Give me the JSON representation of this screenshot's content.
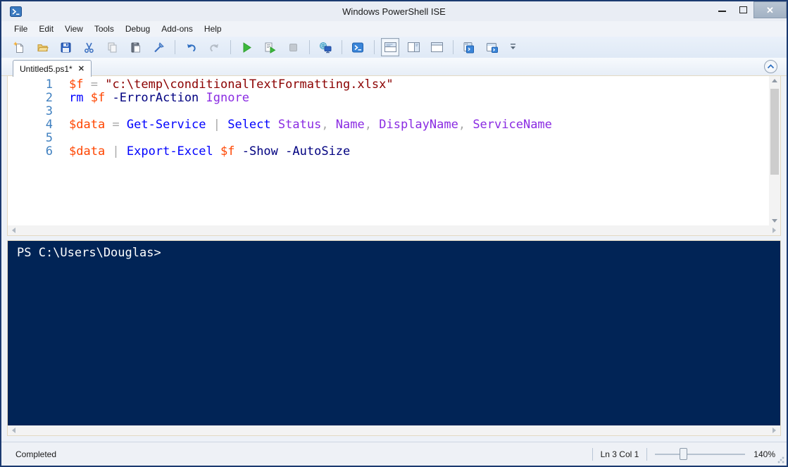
{
  "window": {
    "title": "Windows PowerShell ISE",
    "controls": [
      "minimize-icon",
      "maximize-icon",
      "close-icon"
    ]
  },
  "menu": {
    "items": [
      "File",
      "Edit",
      "View",
      "Tools",
      "Debug",
      "Add-ons",
      "Help"
    ]
  },
  "toolbar": {
    "items": [
      "new-script-icon",
      "open-script-icon",
      "save-icon",
      "cut-icon",
      "copy-icon",
      "paste-icon",
      "clear-console-icon",
      "undo-icon",
      "redo-icon",
      "run-script-icon",
      "run-selection-icon",
      "stop-icon",
      "new-remote-powershell-tab-icon",
      "start-powershell-icon",
      "show-script-pane-top-icon",
      "show-script-pane-right-icon",
      "show-script-pane-maximized-icon",
      "new-powershell-tab-icon",
      "start-powershell-exe-icon",
      "toolbar-overflow-icon"
    ]
  },
  "tabs": {
    "active": {
      "label": "Untitled5.ps1*",
      "close_glyph": "✕"
    }
  },
  "editor": {
    "token_colors": {
      "plain": "#000000",
      "variable": "#ff4500",
      "operator": "#a9a9a9",
      "string": "#8b0000",
      "cmdlet": "#0000ff",
      "parameter": "#000080",
      "argument": "#8a2be2"
    },
    "line_number_color": "#4080c0",
    "lines": [
      {
        "num": "1",
        "tokens": [
          [
            "variable",
            "$f"
          ],
          [
            "operator",
            " = "
          ],
          [
            "string",
            "\"c:\\temp\\conditionalTextFormatting.xlsx\""
          ]
        ]
      },
      {
        "num": "2",
        "tokens": [
          [
            "cmdlet",
            "rm"
          ],
          [
            "plain",
            " "
          ],
          [
            "variable",
            "$f"
          ],
          [
            "plain",
            " "
          ],
          [
            "parameter",
            "-ErrorAction"
          ],
          [
            "plain",
            " "
          ],
          [
            "argument",
            "Ignore"
          ]
        ]
      },
      {
        "num": "3",
        "tokens": []
      },
      {
        "num": "4",
        "tokens": [
          [
            "variable",
            "$data"
          ],
          [
            "operator",
            " = "
          ],
          [
            "cmdlet",
            "Get-Service"
          ],
          [
            "operator",
            " | "
          ],
          [
            "cmdlet",
            "Select"
          ],
          [
            "plain",
            " "
          ],
          [
            "argument",
            "Status"
          ],
          [
            "operator",
            ", "
          ],
          [
            "argument",
            "Name"
          ],
          [
            "operator",
            ", "
          ],
          [
            "argument",
            "DisplayName"
          ],
          [
            "operator",
            ", "
          ],
          [
            "argument",
            "ServiceName"
          ]
        ]
      },
      {
        "num": "5",
        "tokens": []
      },
      {
        "num": "6",
        "tokens": [
          [
            "variable",
            "$data"
          ],
          [
            "operator",
            " | "
          ],
          [
            "cmdlet",
            "Export-Excel"
          ],
          [
            "plain",
            " "
          ],
          [
            "variable",
            "$f"
          ],
          [
            "plain",
            " "
          ],
          [
            "parameter",
            "-Show"
          ],
          [
            "plain",
            " "
          ],
          [
            "parameter",
            "-AutoSize"
          ]
        ]
      }
    ]
  },
  "console": {
    "prompt": "PS C:\\Users\\Douglas>",
    "background": "#012456",
    "text_color": "#ffffff"
  },
  "statusbar": {
    "status": "Completed",
    "position": "Ln 3 Col 1",
    "zoom": "140%"
  }
}
